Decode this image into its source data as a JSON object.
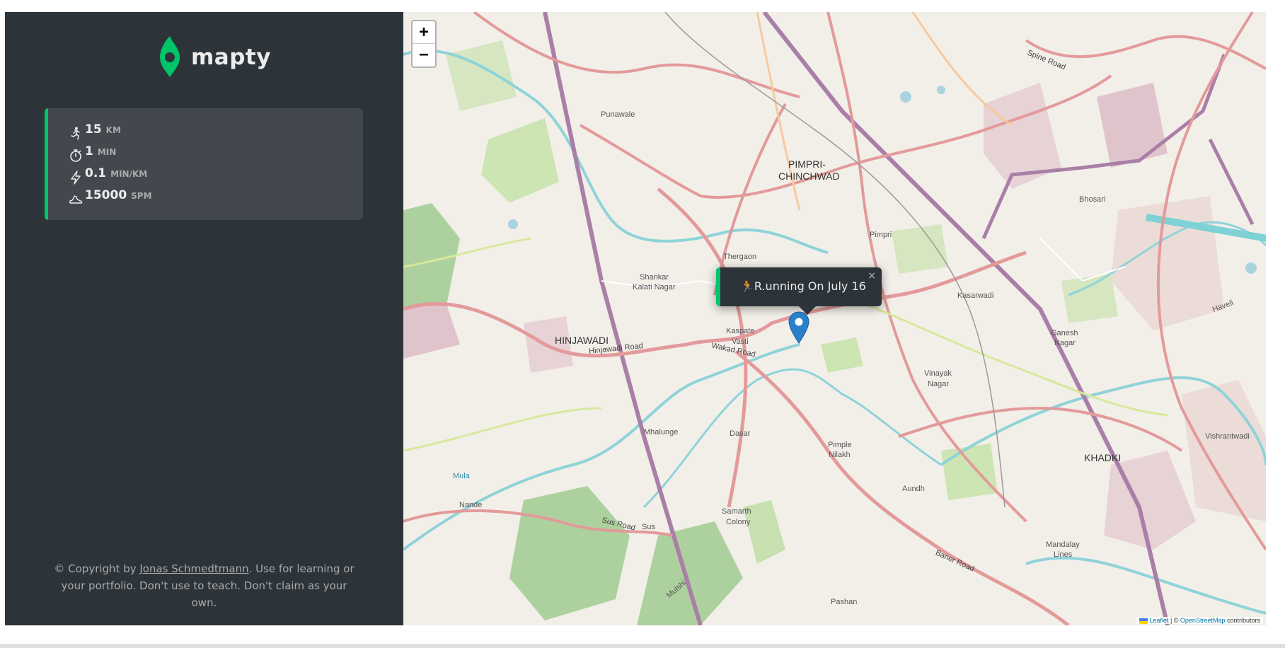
{
  "brand": {
    "name": "mapty",
    "accent": "#00c46a"
  },
  "workout": {
    "type": "running",
    "distance": {
      "value": "15",
      "unit": "km"
    },
    "duration": {
      "value": "1",
      "unit": "min"
    },
    "pace": {
      "value": "0.1",
      "unit": "min/km"
    },
    "cadence": {
      "value": "15000",
      "unit": "spm"
    }
  },
  "footer": {
    "prefix": "© Copyright by ",
    "author": "Jonas Schmedtmann",
    "suffix": ". Use for learning or your portfolio. Don't use to teach. Don't claim as your own."
  },
  "map": {
    "zoom_in": "+",
    "zoom_out": "−",
    "popup_text": "R.unning On July 16",
    "popup_close": "×",
    "attribution": {
      "leaflet": "Leaflet",
      "sep": " | © ",
      "osm": "OpenStreetMap",
      "tail": " contributors"
    },
    "labels": {
      "pimpri": "PIMPRI-",
      "chinchwad": "CHINCHWAD",
      "hinjawadi": "HINJAWADI",
      "khadki": "KHADKI",
      "punawale": "Punawale",
      "thergaon": "Thergaon",
      "shankar": "Shankar",
      "kalati": "Kalati Nagar",
      "kaspate": "Kaspate",
      "vasti": "Vasti",
      "wakad": "Wakad Road",
      "hinjroad": "Hinjawadi Road",
      "pimpri_small": "Pimpri",
      "bhosari": "Bhosari",
      "kasarwadi": "Kasarwadi",
      "ganesh": "Ganesh",
      "nagar": "Nagar",
      "vinayak": "Vinayak",
      "vnagar": "Nagar",
      "mhalunge": "Mhalunge",
      "dasar": "Dasar",
      "pimple": "Pimple",
      "nilakh": "Nilakh",
      "aundh": "Aundh",
      "samarth": "Samarth",
      "colony": "Colony",
      "nande": "Nande",
      "sus": "Sus",
      "susroad": "Sus Road",
      "mula": "Mula",
      "mandalay": "Mandalay",
      "lines": "Lines",
      "pashan": "Pashan",
      "baner": "Baner Road",
      "vishrantwadi": "Vishrantwadi",
      "haveli": "Haveli",
      "spine": "Spine Road",
      "mulshi": "Mulshi"
    }
  }
}
